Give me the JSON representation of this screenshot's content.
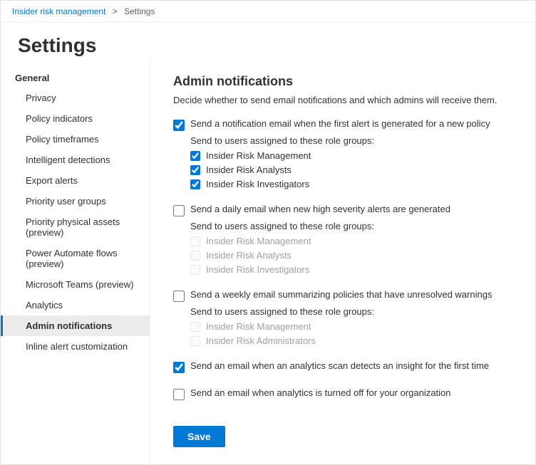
{
  "breadcrumb": {
    "parent": "Insider risk management",
    "separator": ">",
    "current": "Settings"
  },
  "page_title": "Settings",
  "nav": {
    "group_label": "General",
    "items": [
      {
        "id": "privacy",
        "label": "Privacy"
      },
      {
        "id": "policy-indicators",
        "label": "Policy indicators"
      },
      {
        "id": "policy-timeframes",
        "label": "Policy timeframes"
      },
      {
        "id": "intelligent-detections",
        "label": "Intelligent detections"
      },
      {
        "id": "export-alerts",
        "label": "Export alerts"
      },
      {
        "id": "priority-user-groups",
        "label": "Priority user groups"
      },
      {
        "id": "priority-physical-assets",
        "label": "Priority physical assets (preview)"
      },
      {
        "id": "power-automate-flows",
        "label": "Power Automate flows (preview)"
      },
      {
        "id": "microsoft-teams",
        "label": "Microsoft Teams (preview)"
      },
      {
        "id": "analytics",
        "label": "Analytics"
      },
      {
        "id": "admin-notifications",
        "label": "Admin notifications",
        "active": true
      },
      {
        "id": "inline-alert-customization",
        "label": "Inline alert customization"
      }
    ]
  },
  "content": {
    "section_title": "Admin notifications",
    "section_desc": "Decide whether to send email notifications and which admins will receive them.",
    "notifications": [
      {
        "id": "new-policy-alert",
        "label": "Send a notification email when the first alert is generated for a new policy",
        "checked": true,
        "has_roles": true,
        "roles_label": "Send to users assigned to these role groups:",
        "roles": [
          {
            "label": "Insider Risk Management",
            "checked": true,
            "disabled": false
          },
          {
            "label": "Insider Risk Analysts",
            "checked": true,
            "disabled": false
          },
          {
            "label": "Insider Risk Investigators",
            "checked": true,
            "disabled": false
          }
        ]
      },
      {
        "id": "daily-high-severity",
        "label": "Send a daily email when new high severity alerts are generated",
        "checked": false,
        "has_roles": true,
        "roles_label": "Send to users assigned to these role groups:",
        "roles": [
          {
            "label": "Insider Risk Management",
            "checked": false,
            "disabled": true
          },
          {
            "label": "Insider Risk Analysts",
            "checked": false,
            "disabled": true
          },
          {
            "label": "Insider Risk Investigators",
            "checked": false,
            "disabled": true
          }
        ]
      },
      {
        "id": "weekly-unresolved-warnings",
        "label": "Send a weekly email summarizing policies that have unresolved warnings",
        "checked": false,
        "has_roles": true,
        "roles_label": "Send to users assigned to these role groups:",
        "roles": [
          {
            "label": "Insider Risk Management",
            "checked": false,
            "disabled": true
          },
          {
            "label": "Insider Risk Administrators",
            "checked": false,
            "disabled": true
          }
        ]
      },
      {
        "id": "analytics-insight",
        "label": "Send an email when an analytics scan detects an insight for the first time",
        "checked": true,
        "has_roles": false
      },
      {
        "id": "analytics-off",
        "label": "Send an email when analytics is turned off for your organization",
        "checked": false,
        "has_roles": false
      }
    ],
    "save_button_label": "Save"
  }
}
